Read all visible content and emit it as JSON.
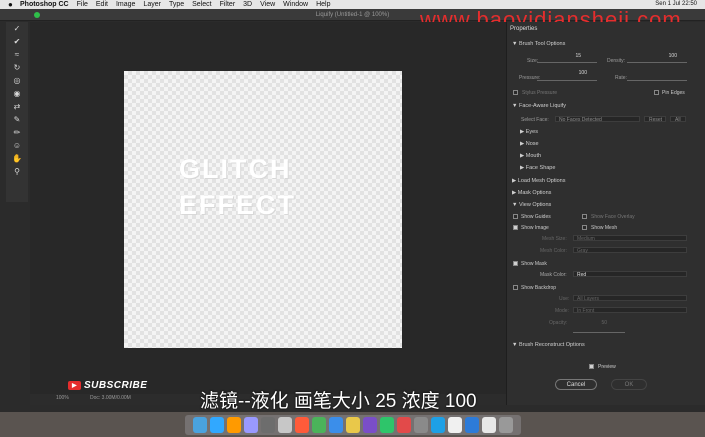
{
  "menubar": {
    "apple": "",
    "app_name": "Photoshop CC",
    "items": [
      "File",
      "Edit",
      "Image",
      "Layer",
      "Type",
      "Select",
      "Filter",
      "3D",
      "View",
      "Window",
      "Help"
    ],
    "status": "Sen 1 Jul 22:50"
  },
  "window_title": "Liquify (Untitled-1 @ 100%)",
  "watermark": "www.baoyidiansheji.com",
  "canvas": {
    "line1": "GLITCH",
    "line2": "EFFECT"
  },
  "status_zoom": "100%",
  "status_doc": "Doc: 3.00M/0.00M",
  "panel": {
    "title": "Properties",
    "brush_tool_options": "Brush Tool Options",
    "size_label": "Size:",
    "size_value": "15",
    "density_label": "Density:",
    "density_value": "100",
    "pressure_label": "Pressure:",
    "pressure_value": "100",
    "rate_label": "Rate:",
    "stylus_pressure": "Stylus Pressure",
    "pin_edges": "Pin Edges",
    "face_aware": "Face-Aware Liquify",
    "select_face_label": "Select Face:",
    "select_face_value": "No Faces Detected",
    "reset_btn": "Reset",
    "all_btn": "All",
    "eyes": "Eyes",
    "nose": "Nose",
    "mouth": "Mouth",
    "face_shape": "Face Shape",
    "load_mesh": "Load Mesh Options",
    "mask_options": "Mask Options",
    "view_options": "View Options",
    "show_guides": "Show Guides",
    "show_face_overlay": "Show Face Overlay",
    "show_image": "Show Image",
    "show_mesh": "Show Mesh",
    "mesh_size_label": "Mesh Size:",
    "mesh_size_value": "Medium",
    "mesh_color_label": "Mesh Color:",
    "mesh_color_value": "Gray",
    "show_mask": "Show Mask",
    "mask_color_label": "Mask Color:",
    "mask_color_value": "Red",
    "show_backdrop": "Show Backdrop",
    "use_label": "Use:",
    "use_value": "All Layers",
    "mode_label": "Mode:",
    "mode_value": "In Front",
    "opacity_label": "Opacity:",
    "opacity_value": "50",
    "brush_reconstruct": "Brush Reconstruct Options",
    "preview": "Preview",
    "cancel": "Cancel",
    "ok": "OK"
  },
  "subscribe": "SUBSCRIBE",
  "subtitle": "滤镜--液化 画笔大小 25 浓度 100",
  "colors": {
    "accent_red": "#e52d2d",
    "canvas_bg": "#282828",
    "panel_bg": "#2f2f2f"
  }
}
